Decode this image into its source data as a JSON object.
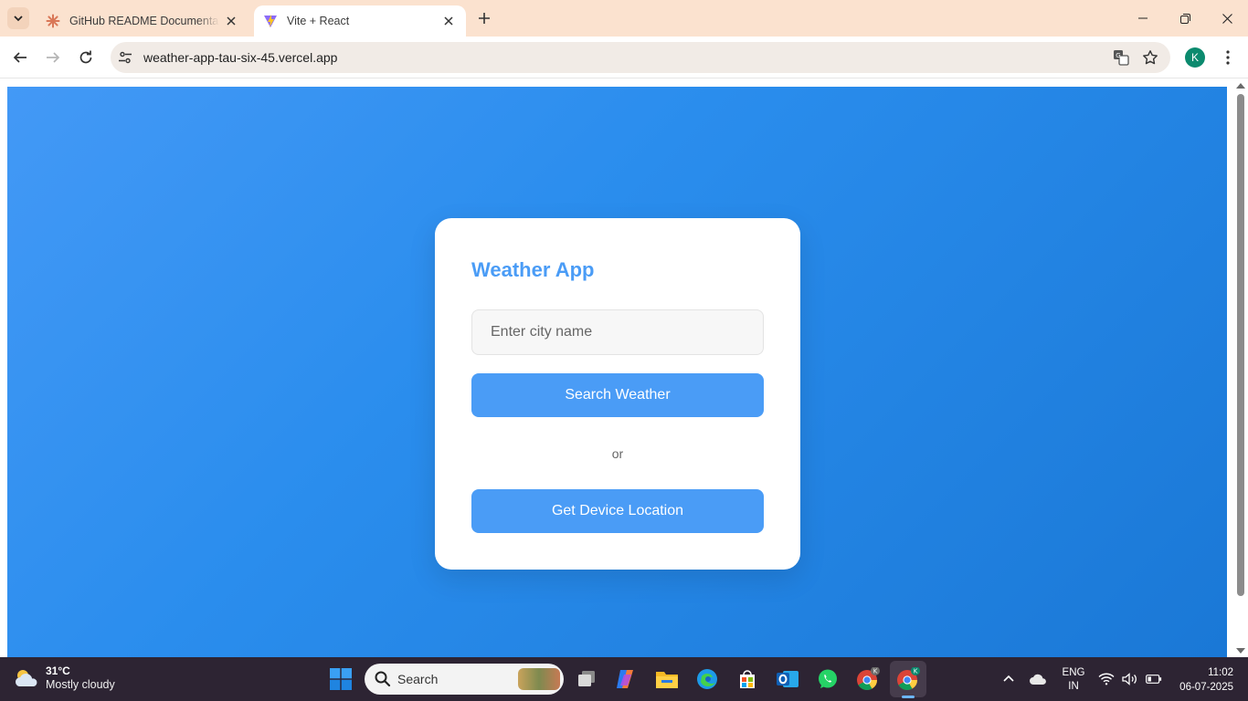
{
  "browser": {
    "tabs": [
      {
        "title": "GitHub README Documentation",
        "active": false,
        "favicon": "claude-sunburst-icon"
      },
      {
        "title": "Vite + React",
        "active": true,
        "favicon": "vite-logo-icon"
      }
    ],
    "url": "weather-app-tau-six-45.vercel.app",
    "profile_initial": "K"
  },
  "page": {
    "title": "Weather App",
    "search": {
      "placeholder": "Enter city name",
      "value": ""
    },
    "search_button": "Search Weather",
    "divider_text": "or",
    "location_button": "Get Device Location"
  },
  "colors": {
    "accent": "#4a9cf6",
    "background_gradient_start": "#4399f6",
    "background_gradient_end": "#1a78d6",
    "tabstrip": "#fbe2cf",
    "taskbar": "#2d2433"
  },
  "taskbar": {
    "weather": {
      "temp": "31°C",
      "desc": "Mostly cloudy"
    },
    "search_label": "Search",
    "apps": [
      "task-view-icon",
      "copilot-icon",
      "file-explorer-icon",
      "edge-icon",
      "store-icon",
      "outlook-icon",
      "whatsapp-icon",
      "chrome-icon",
      "chrome-icon"
    ],
    "language": {
      "line1": "ENG",
      "line2": "IN"
    },
    "time": "11:02",
    "date": "06-07-2025"
  }
}
